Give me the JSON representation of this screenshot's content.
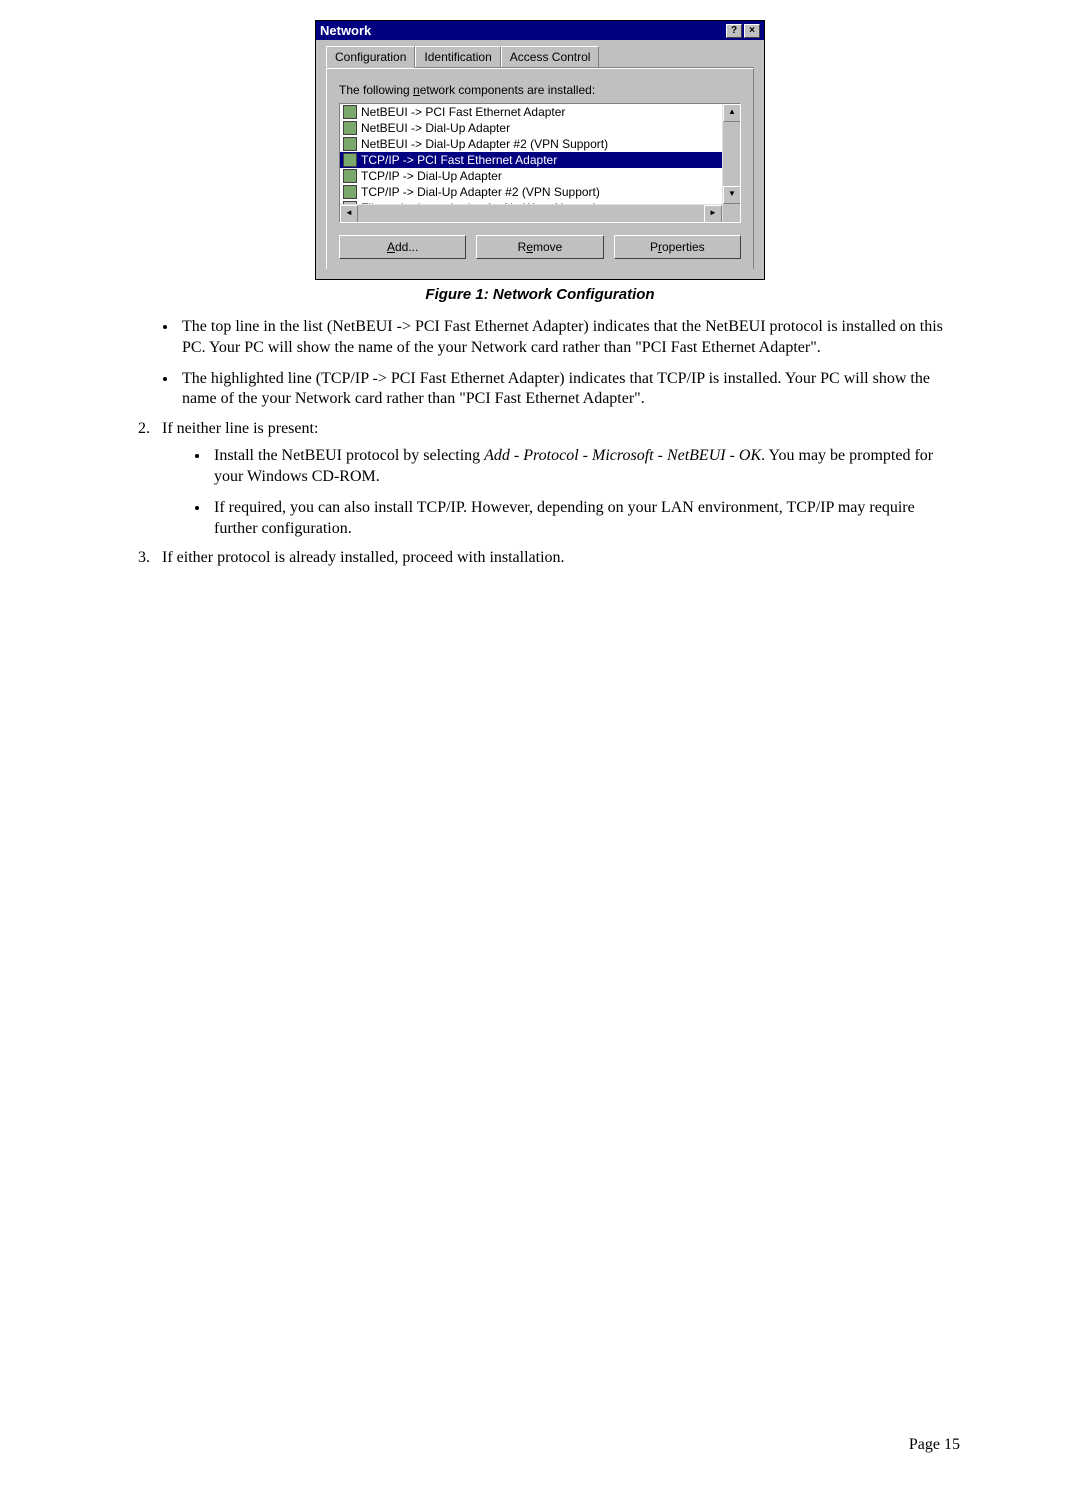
{
  "dialog": {
    "title": "Network",
    "help_btn": "?",
    "close_btn": "×",
    "tabs": {
      "configuration": "Configuration",
      "identification": "Identification",
      "access_control": "Access Control"
    },
    "instruction_pre": "The following ",
    "instruction_underlined": "n",
    "instruction_post": "etwork components are installed:",
    "items": [
      "NetBEUI -> PCI Fast Ethernet Adapter",
      "NetBEUI -> Dial-Up Adapter",
      "NetBEUI -> Dial-Up Adapter #2 (VPN Support)",
      "TCP/IP -> PCI Fast Ethernet Adapter",
      "TCP/IP -> Dial-Up Adapter",
      "TCP/IP -> Dial-Up Adapter #2 (VPN Support)",
      "File and printer sharing for NetWare Networks"
    ],
    "add_pre": "A",
    "add_post": "dd...",
    "remove_pre": "R",
    "remove_mid": "e",
    "remove_post": "move",
    "properties_pre": "P",
    "properties_mid": "r",
    "properties_post": "operties"
  },
  "figure_caption": "Figure 1: Network Configuration",
  "bullets_top": [
    "The top line in the list (NetBEUI -> PCI Fast Ethernet Adapter) indicates that the NetBEUI protocol is installed on this PC. Your PC will show the name of the your Network card rather than \"PCI Fast Ethernet Adapter\".",
    "The highlighted line (TCP/IP -> PCI Fast Ethernet Adapter) indicates that TCP/IP is installed. Your PC will show the name of the your Network card rather than \"PCI Fast Ethernet Adapter\"."
  ],
  "ol": {
    "item2": "If neither line is present:",
    "nested": [
      {
        "pre": "Install the NetBEUI protocol by selecting ",
        "italic": "Add - Protocol - Microsoft - NetBEUI - OK",
        "post": ". You may be prompted for your Windows CD-ROM."
      },
      {
        "pre": "If required, you can also install TCP/IP. However, depending on your LAN environment, TCP/IP may require further configuration.",
        "italic": "",
        "post": ""
      }
    ],
    "item3": "If either protocol is already installed, proceed with installation."
  },
  "page_number": "Page 15"
}
